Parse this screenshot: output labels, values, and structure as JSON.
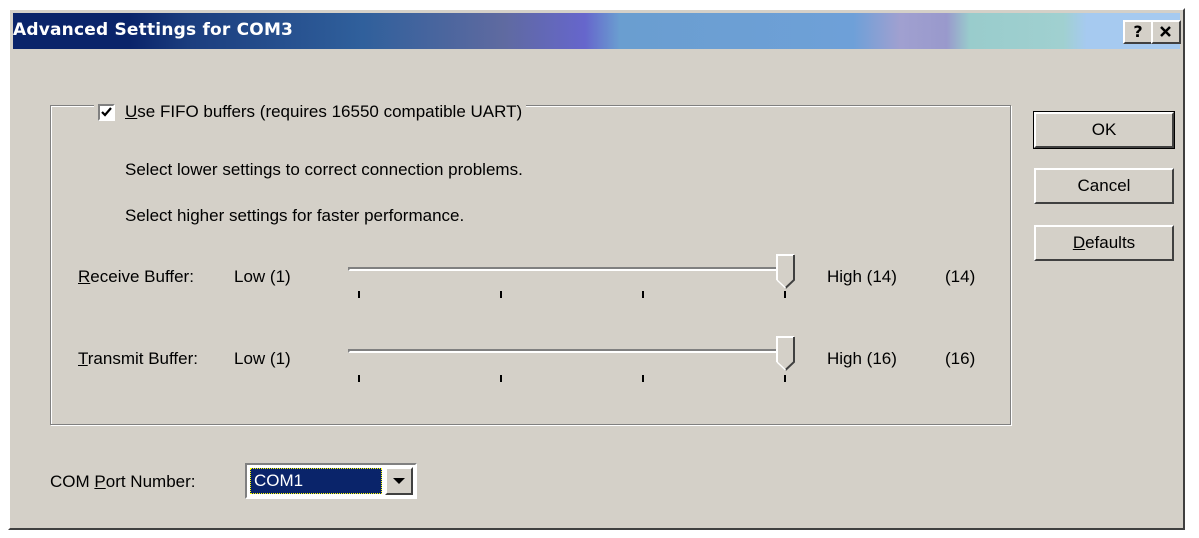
{
  "window": {
    "title": "Advanced Settings for COM3",
    "help_button": "?",
    "close_button": "×"
  },
  "fifo": {
    "checked": true,
    "label_accel": "U",
    "label_rest": "se FIFO buffers (requires 16550 compatible UART)",
    "hint_lower": "Select lower settings to correct connection problems.",
    "hint_higher": "Select higher settings for faster performance."
  },
  "receive": {
    "label_accel": "R",
    "label_rest": "eceive Buffer:",
    "low": "Low (1)",
    "high": "High (14)",
    "current": "(14)",
    "value_fraction": 1.0
  },
  "transmit": {
    "label_accel": "T",
    "label_rest": "ransmit Buffer:",
    "low": "Low (1)",
    "high": "High (16)",
    "current": "(16)",
    "value_fraction": 1.0
  },
  "buttons": {
    "ok": "OK",
    "cancel": "Cancel",
    "defaults_accel": "D",
    "defaults_rest": "efaults"
  },
  "com_port": {
    "label_pre": "COM ",
    "label_accel": "P",
    "label_rest": "ort Number:",
    "value": "COM1"
  },
  "colors": {
    "dialog_face": "#d4d0c8",
    "selection": "#0a246a"
  }
}
